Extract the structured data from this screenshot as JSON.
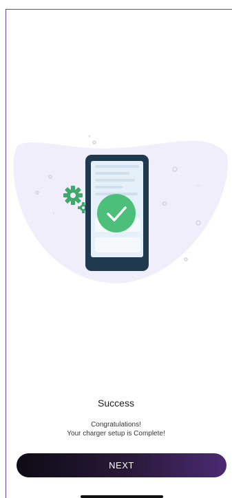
{
  "screen": {
    "title": "Success",
    "message_line1": "Congratulations!",
    "message_line2": "Your charger setup is Complete!"
  },
  "actions": {
    "next_label": "NEXT"
  },
  "illustration": {
    "blob_color": "#f1eefb",
    "phone_frame_color": "#1f3a4e",
    "screen_color": "#e6f0f8",
    "check_color": "#4cbf7a",
    "gear_color": "#3fa86b",
    "icons": [
      "phone-icon",
      "checkmark-icon",
      "gear-icon"
    ]
  }
}
